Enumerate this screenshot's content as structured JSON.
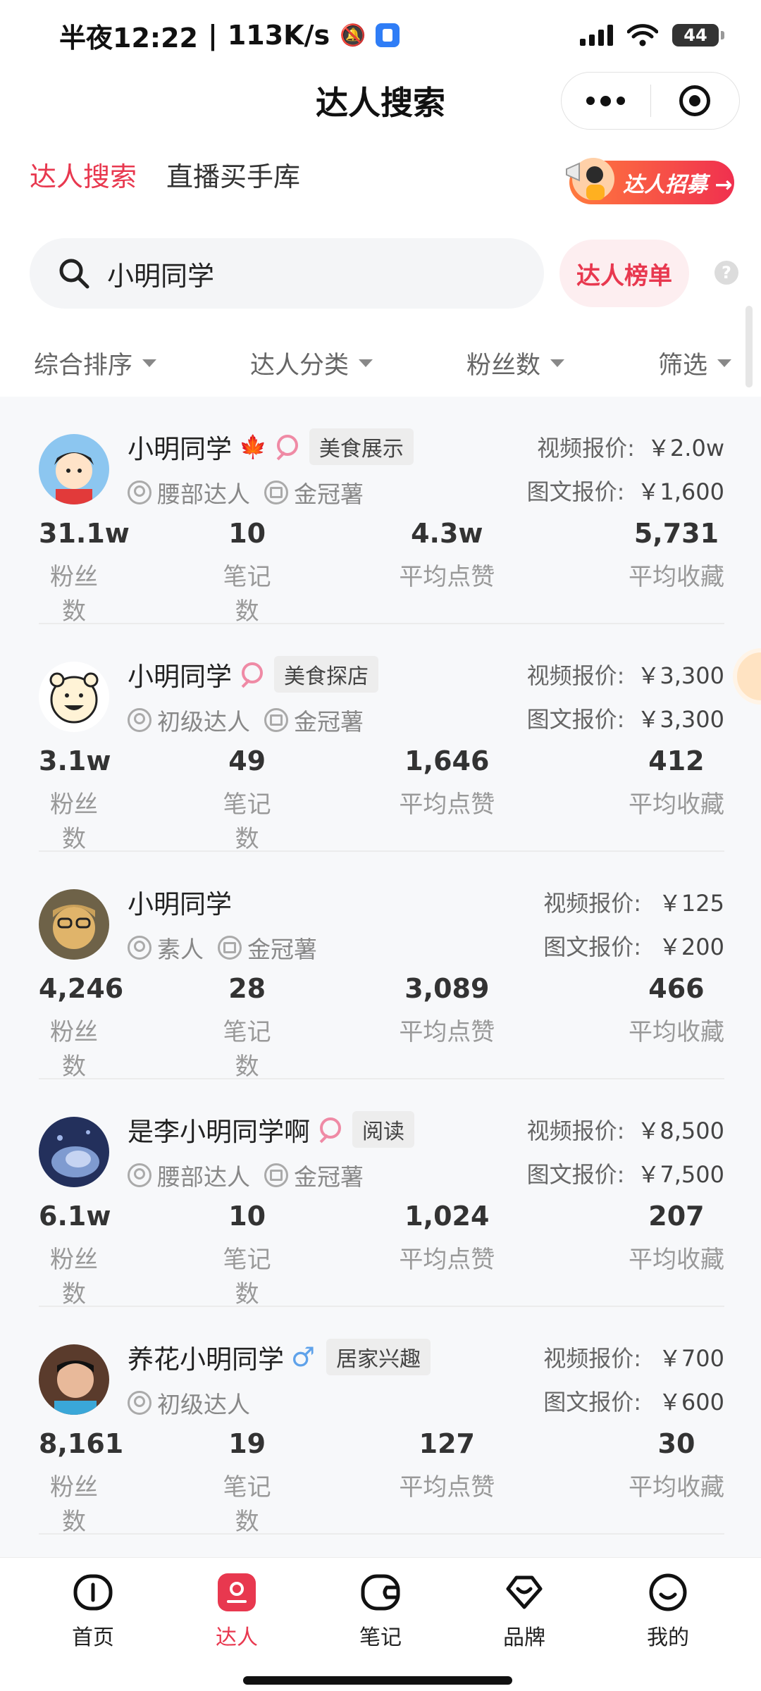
{
  "status_bar": {
    "time": "半夜12:22",
    "speed": "113K/s",
    "battery": "44"
  },
  "header": {
    "title": "达人搜索"
  },
  "top_tabs": [
    {
      "label": "达人搜索",
      "active": true
    },
    {
      "label": "直播买手库",
      "active": false
    }
  ],
  "banner": {
    "label": "达人招募 →"
  },
  "search": {
    "value": "小明同学",
    "rank_button": "达人榜单",
    "help": "?"
  },
  "filters": [
    "综合排序",
    "达人分类",
    "粉丝数",
    "筛选"
  ],
  "labels": {
    "video_price": "视频报价:",
    "image_price": "图文报价:",
    "fans": "粉丝数",
    "notes": "笔记数",
    "avg_likes": "平均点赞",
    "avg_collects": "平均收藏"
  },
  "creators": [
    {
      "name": "小明同学",
      "gender": "female",
      "extra_icon": "maple-leaf-icon",
      "tag": "美食展示",
      "level": "腰部达人",
      "badge": "金冠薯",
      "video_price": "￥2.0w",
      "image_price": "￥1,600",
      "fans": "31.1w",
      "notes": "10",
      "avg_likes": "4.3w",
      "avg_collects": "5,731"
    },
    {
      "name": "小明同学",
      "gender": "female",
      "tag": "美食探店",
      "level": "初级达人",
      "badge": "金冠薯",
      "video_price": "￥3,300",
      "image_price": "￥3,300",
      "fans": "3.1w",
      "notes": "49",
      "avg_likes": "1,646",
      "avg_collects": "412"
    },
    {
      "name": "小明同学",
      "gender": "none",
      "tag": "",
      "level": "素人",
      "badge": "金冠薯",
      "video_price": "￥125",
      "image_price": "￥200",
      "fans": "4,246",
      "notes": "28",
      "avg_likes": "3,089",
      "avg_collects": "466"
    },
    {
      "name": "是李小明同学啊",
      "gender": "female",
      "tag": "阅读",
      "level": "腰部达人",
      "badge": "金冠薯",
      "video_price": "￥8,500",
      "image_price": "￥7,500",
      "fans": "6.1w",
      "notes": "10",
      "avg_likes": "1,024",
      "avg_collects": "207"
    },
    {
      "name": "养花小明同学",
      "gender": "male",
      "tag": "居家兴趣",
      "level": "初级达人",
      "badge": "",
      "video_price": "￥700",
      "image_price": "￥600",
      "fans": "8,161",
      "notes": "19",
      "avg_likes": "127",
      "avg_collects": "30"
    }
  ],
  "bottom_nav": [
    {
      "label": "首页",
      "icon": "home-icon",
      "active": false
    },
    {
      "label": "达人",
      "icon": "creator-icon",
      "active": true
    },
    {
      "label": "笔记",
      "icon": "notes-icon",
      "active": false
    },
    {
      "label": "品牌",
      "icon": "brand-icon",
      "active": false
    },
    {
      "label": "我的",
      "icon": "profile-icon",
      "active": false
    }
  ],
  "colors": {
    "accent": "#e8384f",
    "list_bg": "#f7f8fa",
    "female": "#ef8aa5",
    "male": "#5fa2ea"
  }
}
